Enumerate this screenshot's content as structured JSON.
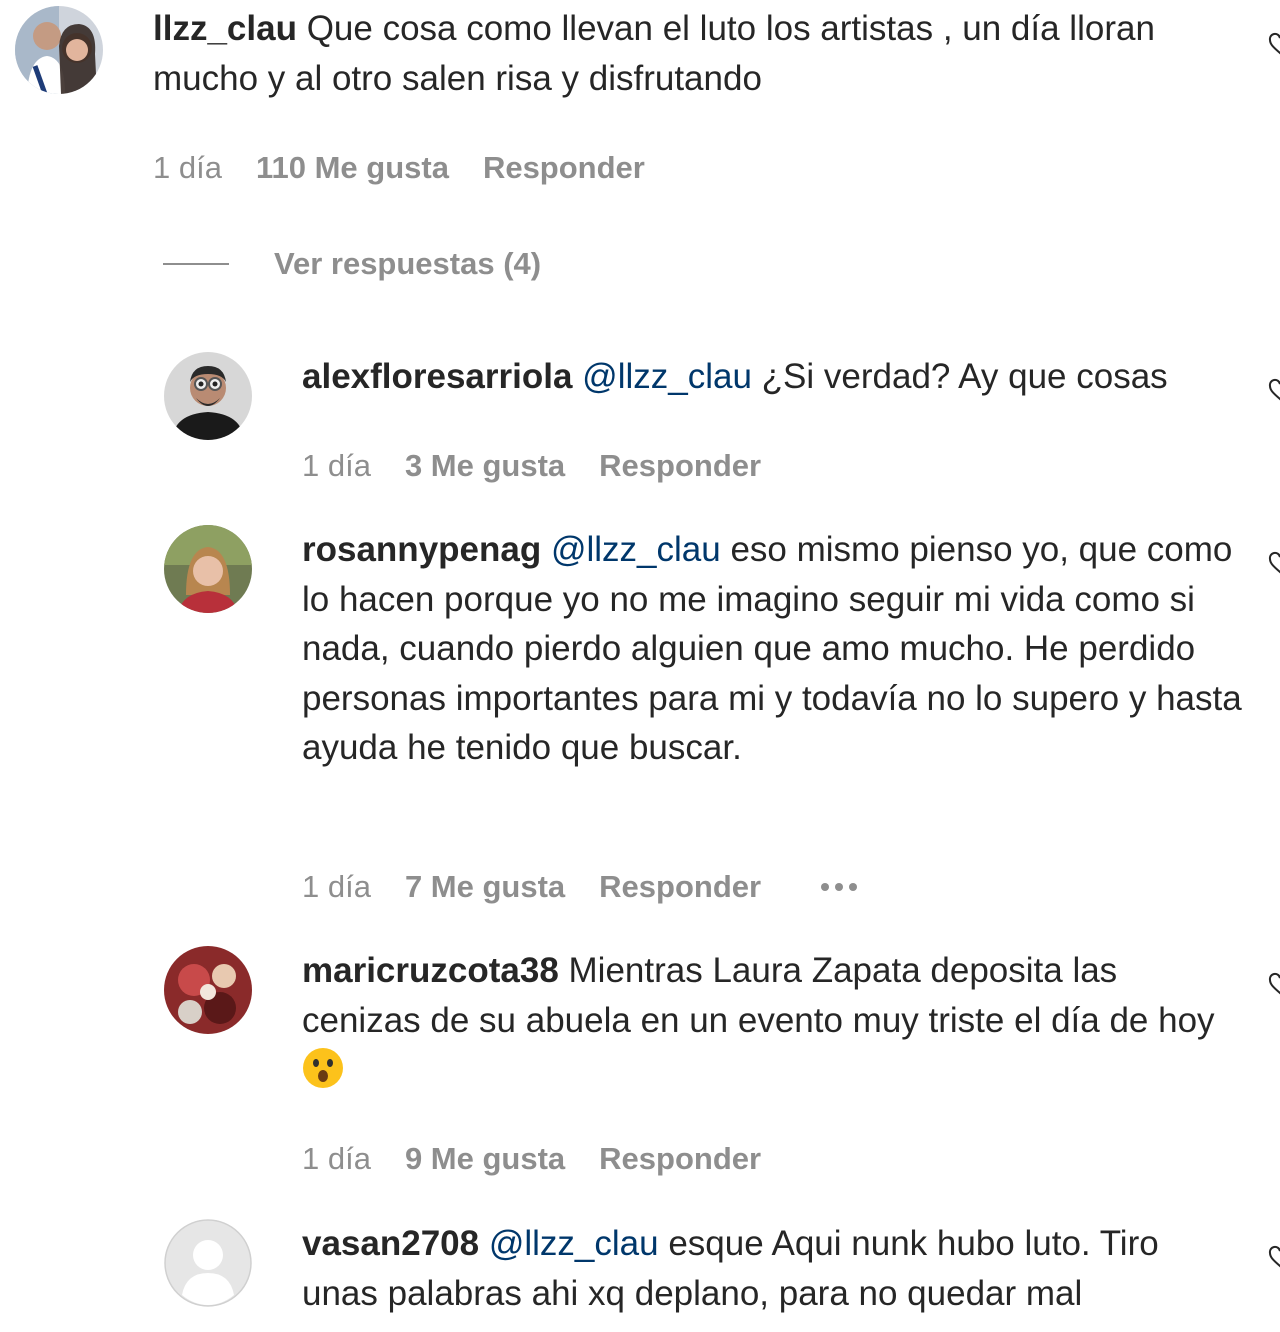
{
  "comments": [
    {
      "username": "llzz_clau",
      "mention": "",
      "text": "Que cosa como llevan el luto los artistas , un día lloran mucho y al otro salen risa y disfrutando",
      "time": "1 día",
      "likes": "110 Me gusta",
      "reply": "Responder"
    }
  ],
  "view_replies": "Ver respuestas (4)",
  "replies": [
    {
      "username": "alexfloresarriola",
      "mention": "@llzz_clau",
      "text": "¿Si verdad? Ay que cosas",
      "time": "1 día",
      "likes": "3 Me gusta",
      "reply": "Responder"
    },
    {
      "username": "rosannypenag",
      "mention": "@llzz_clau",
      "text": "eso mismo pienso yo, que como lo hacen porque yo no me imagino seguir mi vida como si nada, cuando pierdo alguien que amo mucho. He perdido personas importantes para mi y todavía no lo supero y hasta ayuda he tenido que buscar.",
      "time": "1 día",
      "likes": "7 Me gusta",
      "reply": "Responder"
    },
    {
      "username": "maricruzcota38",
      "mention": "",
      "text": "Mientras Laura Zapata deposita las cenizas de su abuela en un evento muy triste el día de hoy",
      "emoji": "hushed-face-emoji",
      "time": "1 día",
      "likes": "9 Me gusta",
      "reply": "Responder"
    },
    {
      "username": "vasan2708",
      "mention": "@llzz_clau",
      "text": "esque Aqui nunk hubo luto. Tiro unas palabras ahi xq deplano, para no quedar mal"
    }
  ],
  "colors": {
    "text": "#262626",
    "muted": "#8e8e8e",
    "mention": "#00376b"
  }
}
